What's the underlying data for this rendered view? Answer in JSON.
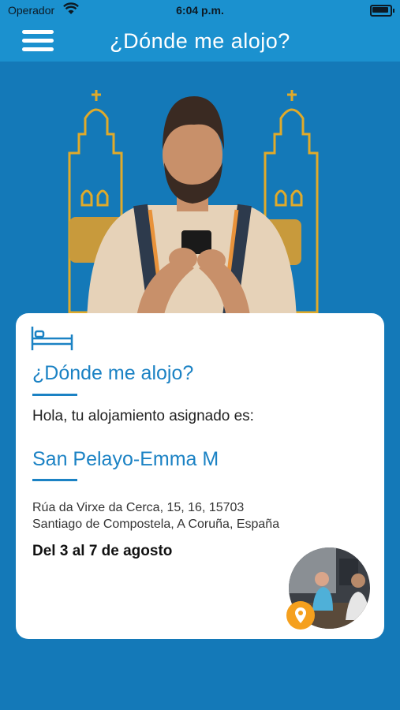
{
  "status_bar": {
    "carrier": "Operador",
    "time": "6:04 p.m."
  },
  "nav": {
    "title": "¿Dónde me alojo?"
  },
  "card": {
    "title": "¿Dónde me alojo?",
    "greeting": "Hola, tu alojamiento asignado es:",
    "accommodation": "San Pelayo-Emma M",
    "address_line1": "Rúa da Virxe da Cerca, 15, 16, 15703",
    "address_line2": "Santiago de Compostela, A Coruña, España",
    "dates": "Del 3 al 7 de agosto"
  },
  "colors": {
    "nav": "#1b91cf",
    "background": "#1479b8",
    "accent": "#1b82c4",
    "pin": "#f5a01e",
    "tower": "#e0aa2a"
  },
  "icons": [
    "wifi-icon",
    "battery-icon",
    "hamburger-menu-icon",
    "bed-icon",
    "location-pin-icon"
  ]
}
